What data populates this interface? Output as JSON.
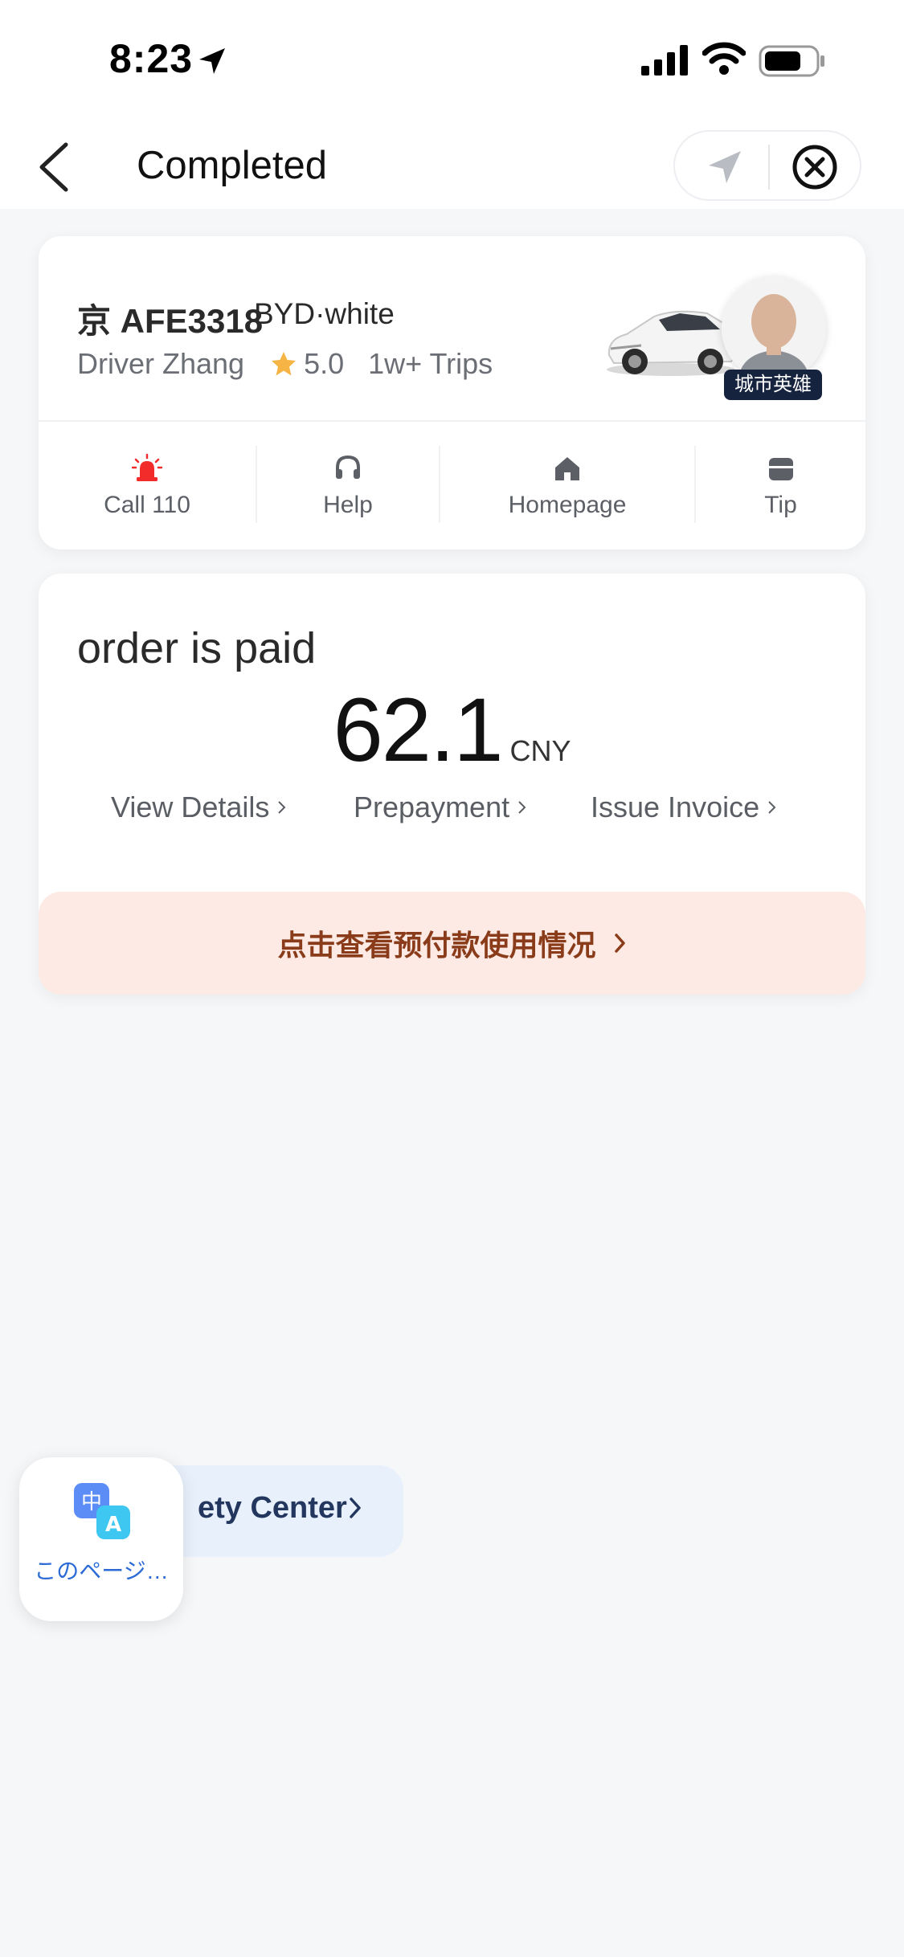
{
  "status_bar": {
    "time": "8:23"
  },
  "nav": {
    "title": "Completed"
  },
  "driver": {
    "plate": "京 AFE3318",
    "car_model": "BYD·white",
    "name": "Driver Zhang",
    "rating": "5.0",
    "trips": "1w+ Trips",
    "badge": "城市英雄"
  },
  "actions": [
    {
      "label": "Call 110",
      "icon": "alarm-icon",
      "color": "#f22b2b"
    },
    {
      "label": "Help",
      "icon": "headset-icon",
      "color": "#5c5f66"
    },
    {
      "label": "Homepage",
      "icon": "home-icon",
      "color": "#5c5f66"
    },
    {
      "label": "Tip",
      "icon": "wallet-icon",
      "color": "#5c5f66"
    }
  ],
  "payment": {
    "status": "order is paid",
    "amount": "62.1",
    "currency": "CNY",
    "links": {
      "view_details": "View Details",
      "prepayment": "Prepayment",
      "issue_invoice": "Issue Invoice"
    },
    "prepay_banner": "点击查看预付款使用情况"
  },
  "safety": {
    "label": "ety Center"
  },
  "translate": {
    "label": "このページ…"
  },
  "colors": {
    "star": "#f5b443",
    "prepay_bg": "#fdeae4",
    "prepay_text": "#8a3c1a",
    "safety_bg": "#e8f0fc",
    "translate_text": "#2c6bd6"
  }
}
